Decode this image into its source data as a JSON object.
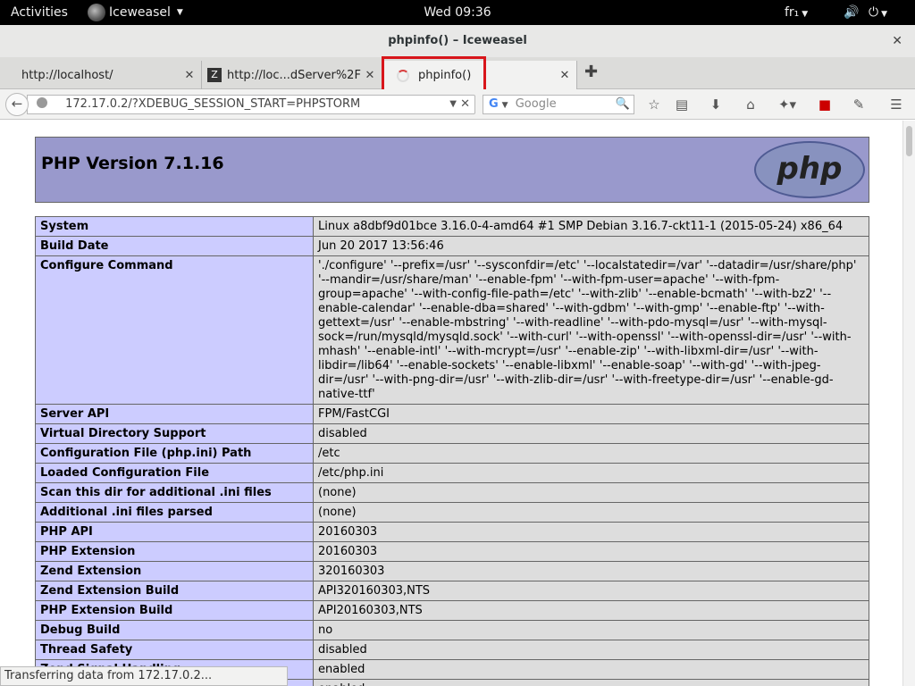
{
  "topbar": {
    "activities": "Activities",
    "app_name": "Iceweasel",
    "clock": "Wed 09:36",
    "keyboard": "fr₁"
  },
  "window": {
    "title": "phpinfo() – Iceweasel"
  },
  "tabs": [
    {
      "label": "http://localhost/"
    },
    {
      "label": "http://loc...dServer%2F"
    },
    {
      "label": "phpinfo()"
    }
  ],
  "nav": {
    "url": "172.17.0.2/?XDEBUG_SESSION_START=PHPSTORM",
    "search_placeholder": "Google"
  },
  "page": {
    "title": "PHP Version 7.1.16",
    "logo_text": "php",
    "rows": [
      {
        "key": "System",
        "value": "Linux a8dbf9d01bce 3.16.0-4-amd64 #1 SMP Debian 3.16.7-ckt11-1 (2015-05-24) x86_64"
      },
      {
        "key": "Build Date",
        "value": "Jun 20 2017 13:56:46"
      },
      {
        "key": "Configure Command",
        "value": "'./configure' '--prefix=/usr' '--sysconfdir=/etc' '--localstatedir=/var' '--datadir=/usr/share/php' '--mandir=/usr/share/man' '--enable-fpm' '--with-fpm-user=apache' '--with-fpm-group=apache' '--with-config-file-path=/etc' '--with-zlib' '--enable-bcmath' '--with-bz2' '--enable-calendar' '--enable-dba=shared' '--with-gdbm' '--with-gmp' '--enable-ftp' '--with-gettext=/usr' '--enable-mbstring' '--with-readline' '--with-pdo-mysql=/usr' '--with-mysql-sock=/run/mysqld/mysqld.sock' '--with-curl' '--with-openssl' '--with-openssl-dir=/usr' '--with-mhash' '--enable-intl' '--with-mcrypt=/usr' '--enable-zip' '--with-libxml-dir=/usr' '--with-libdir=/lib64' '--enable-sockets' '--enable-libxml' '--enable-soap' '--with-gd' '--with-jpeg-dir=/usr' '--with-png-dir=/usr' '--with-zlib-dir=/usr' '--with-freetype-dir=/usr' '--enable-gd-native-ttf'"
      },
      {
        "key": "Server API",
        "value": "FPM/FastCGI"
      },
      {
        "key": "Virtual Directory Support",
        "value": "disabled"
      },
      {
        "key": "Configuration File (php.ini) Path",
        "value": "/etc"
      },
      {
        "key": "Loaded Configuration File",
        "value": "/etc/php.ini"
      },
      {
        "key": "Scan this dir for additional .ini files",
        "value": "(none)"
      },
      {
        "key": "Additional .ini files parsed",
        "value": "(none)"
      },
      {
        "key": "PHP API",
        "value": "20160303"
      },
      {
        "key": "PHP Extension",
        "value": "20160303"
      },
      {
        "key": "Zend Extension",
        "value": "320160303"
      },
      {
        "key": "Zend Extension Build",
        "value": "API320160303,NTS"
      },
      {
        "key": "PHP Extension Build",
        "value": "API20160303,NTS"
      },
      {
        "key": "Debug Build",
        "value": "no"
      },
      {
        "key": "Thread Safety",
        "value": "disabled"
      },
      {
        "key": "Zend Signal Handling",
        "value": "enabled"
      },
      {
        "key": "",
        "value": "enabled"
      }
    ]
  },
  "status": "Transferring data from 172.17.0.2..."
}
